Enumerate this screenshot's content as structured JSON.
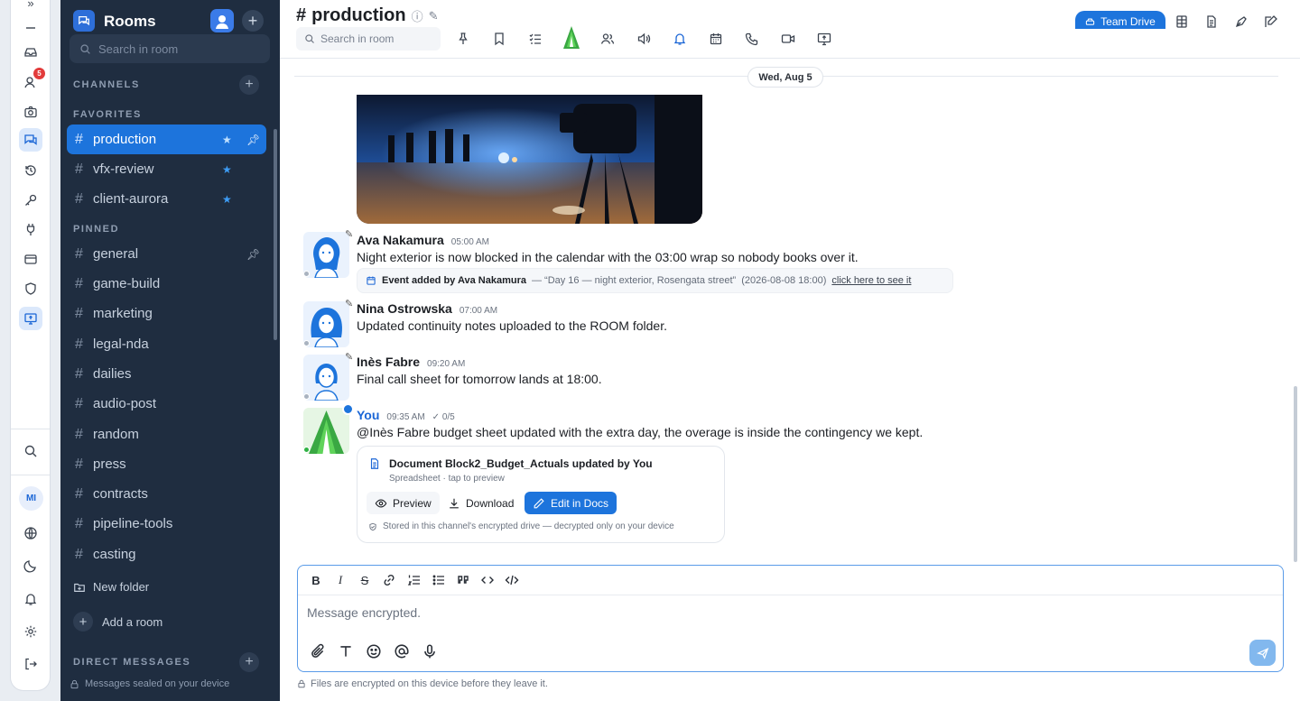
{
  "rail": {
    "notif_count": "5",
    "user_initials": "MI"
  },
  "sidebar": {
    "title": "Rooms",
    "search_placeholder": "Search in room",
    "sec_channels": "CHANNELS",
    "sec_favorites": "FAVORITES",
    "sec_pinned": "PINNED",
    "sec_dm": "DIRECT MESSAGES",
    "favorites": [
      "production",
      "vfx-review",
      "client-aurora"
    ],
    "pinned": [
      "general",
      "game-build",
      "marketing",
      "legal-nda",
      "dailies",
      "audio-post",
      "random",
      "press",
      "contracts",
      "pipeline-tools",
      "casting"
    ],
    "new_folder": "New folder",
    "add_room": "Add a room",
    "sealed": "Messages sealed on your device"
  },
  "room": {
    "title": "production",
    "search_placeholder": "Search in room",
    "team_drive": "Team Drive",
    "date": "Wed, Aug 5"
  },
  "messages": [
    {
      "name": "Ava Nakamura",
      "time": "05:00 AM",
      "text": "Night exterior is now blocked in the calendar with the 03:00 wrap so nobody books over it."
    },
    {
      "name": "Nina Ostrowska",
      "time": "07:00 AM",
      "text": "Updated continuity notes uploaded to the ROOM folder."
    },
    {
      "name": "Inès Fabre",
      "time": "09:20 AM",
      "text": "Final call sheet for tomorrow lands at 18:00."
    },
    {
      "name": "You",
      "time": "09:35 AM",
      "read": "0/5",
      "text": "@Inès Fabre budget sheet updated with the extra day, the overage is inside the contingency we kept."
    }
  ],
  "event": {
    "added": "Event added by Ava Nakamura",
    "detail": "— “Day 16 — night exterior, Rosengata street”",
    "when": "(2026-08-08 18:00)",
    "link": "click here to see it"
  },
  "doc": {
    "title": "Document Block2_Budget_Actuals updated by You",
    "subtitle": "Spreadsheet · tap to preview",
    "preview": "Preview",
    "download": "Download",
    "edit": "Edit in Docs",
    "footer": "Stored in this channel's encrypted drive — decrypted only on your device"
  },
  "composer": {
    "placeholder": "Message encrypted.",
    "footer": "Files are encrypted on this device before they leave it."
  },
  "colors": {
    "accent": "#1d74dc",
    "sidebar": "#1f2d40",
    "star": "#3d9cf5"
  }
}
